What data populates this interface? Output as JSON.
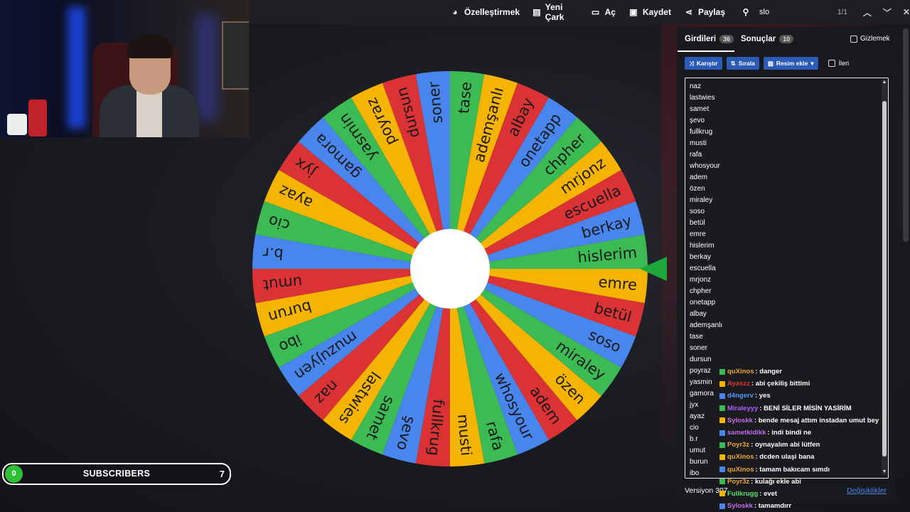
{
  "topbar": {
    "customize_label": "Özelleştirmek",
    "new_wheel_label": "Yeni Çark",
    "open_label": "Aç",
    "save_label": "Kaydet",
    "share_label": "Paylaş",
    "search_value": "slo",
    "search_count": "1/1",
    "nav_up": "^",
    "nav_down": "v",
    "close": "✕"
  },
  "wheel": {
    "segments": [
      "emre",
      "betül",
      "soso",
      "miraley",
      "özen",
      "adem",
      "whosyour",
      "rafa",
      "musti",
      "fullkrug",
      "şevo",
      "samet",
      "lastwies",
      "naz",
      "muzujyen",
      "ibo",
      "burun",
      "umut",
      "b.r",
      "cio",
      "ayaz",
      "jyx",
      "gamora",
      "yasmin",
      "poyraz",
      "dursun",
      "soner",
      "tase",
      "ademşanlı",
      "albay",
      "onetapp",
      "chpher",
      "mrjonz",
      "escuella",
      "berkay",
      "hislerim"
    ],
    "colors": [
      "#f4b400",
      "#db3236",
      "#4885ed",
      "#3cba54"
    ]
  },
  "subscribers": {
    "current": "0",
    "label": "SUBSCRIBERS",
    "goal": "7"
  },
  "panel": {
    "tab_entries": "Girdileri",
    "tab_entries_count": "36",
    "tab_results": "Sonuçlar",
    "tab_results_count": "10",
    "hide_label": "Gizlemek",
    "shuffle_label": "Karıştır",
    "sort_label": "Sırala",
    "add_image_label": "Resim ekle",
    "advanced_label": "İleri",
    "entries": [
      "naz",
      "lastwies",
      "samet",
      "şevo",
      "fullkrug",
      "musti",
      "rafa",
      "whosyour",
      "adem",
      "özen",
      "miraley",
      "soso",
      "betül",
      "emre",
      "hislerim",
      "berkay",
      "escuella",
      "mrjonz",
      "chpher",
      "onetapp",
      "albay",
      "ademşanlı",
      "tase",
      "soner",
      "dursun",
      "poyraz",
      "yasmin",
      "gamora",
      "jyx",
      "ayaz",
      "cio",
      "b.r",
      "umut",
      "burun",
      "ibo"
    ],
    "version_label": "Versiyon 307",
    "changes_label": "Değişiklikler"
  },
  "chat": [
    {
      "user": "quXinos",
      "color": "#f0a42e",
      "msg": ": danger"
    },
    {
      "user": "Ayaszz",
      "color": "#e03030",
      "msg": ": abi çekiliş bittimi"
    },
    {
      "user": "d4ngerv",
      "color": "#4f9cff",
      "msg": ": yes"
    },
    {
      "user": "Miraleyyy",
      "color": "#b05cff",
      "msg": ": BENİ SİLER MİSİN YASİRİM"
    },
    {
      "user": "Syloskk",
      "color": "#c66cf0",
      "msg": ": bende mesaj attım instadan umut bey"
    },
    {
      "user": "sametkidikk",
      "color": "#c66cf0",
      "msg": ": indi bindi ne"
    },
    {
      "user": "Poyr3z",
      "color": "#f0a42e",
      "msg": ": oynayalım abi lütfen"
    },
    {
      "user": "quXinos",
      "color": "#f0a42e",
      "msg": ": dcden ulaşi bana"
    },
    {
      "user": "quXinos",
      "color": "#f0a42e",
      "msg": ": tamam bakıcam sımdı"
    },
    {
      "user": "Poyr3z",
      "color": "#f0a42e",
      "msg": ": kulağı ekle abi"
    },
    {
      "user": "Fullkrugg",
      "color": "#5fe06a",
      "msg": ": evet"
    },
    {
      "user": "Syloskk",
      "color": "#c66cf0",
      "msg": ": tamamdırr"
    }
  ]
}
